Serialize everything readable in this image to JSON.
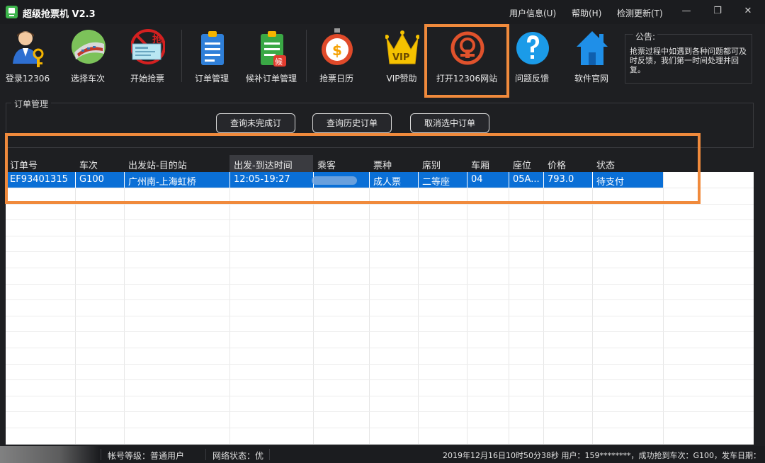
{
  "app": {
    "title": "超级抢票机 V2.3",
    "menu": [
      "用户信息(U)",
      "帮助(H)",
      "检测更新(T)"
    ]
  },
  "toolbar": {
    "items": [
      {
        "label": "登录12306",
        "icon": "user-key-icon"
      },
      {
        "label": "选择车次",
        "icon": "train-icon"
      },
      {
        "label": "开始抢票",
        "icon": "ticket-grab-icon"
      },
      {
        "label": "订单管理",
        "icon": "order-list-icon"
      },
      {
        "label": "候补订单管理",
        "icon": "waitlist-order-icon"
      },
      {
        "label": "抢票日历",
        "icon": "stopwatch-dollar-icon"
      },
      {
        "label": "VIP赞助",
        "icon": "vip-crown-icon"
      },
      {
        "label": "打开12306网站",
        "icon": "railway-logo-icon"
      },
      {
        "label": "问题反馈",
        "icon": "question-icon"
      },
      {
        "label": "软件官网",
        "icon": "home-icon"
      }
    ],
    "ticket_badge": "抢",
    "waitlist_badge": "候",
    "vip_text": "VIP"
  },
  "notice": {
    "title": "公告:",
    "text": "抢票过程中如遇到各种问题都可及时反馈，我们第一时间处理并回复。"
  },
  "orders": {
    "group_title": "订单管理",
    "buttons": [
      "查询未完成订",
      "查询历史订单",
      "取消选中订单"
    ],
    "columns": [
      "订单号",
      "车次",
      "出发站-目的站",
      "出发-到达时间",
      "乘客",
      "票种",
      "席别",
      "车厢",
      "座位",
      "价格",
      "状态"
    ],
    "rows": [
      {
        "order_no": "EF93401315",
        "train": "G100",
        "route": "广州南-上海虹桥",
        "time": "12:05-19:27",
        "passenger": "",
        "ticket_type": "成人票",
        "seat_class": "二等座",
        "car": "04",
        "seat": "05A...",
        "price": "793.0",
        "status": "待支付"
      }
    ],
    "selection_color": "#0a6fd6"
  },
  "statusbar": {
    "level": "帐号等级：普通用户",
    "network": "网络状态：优",
    "info": "2019年12月16日10时50分38秒 用户：159********，成功抢到车次：G100，发车日期："
  },
  "colors": {
    "highlight": "#f08a3c",
    "background": "#1e1f22"
  }
}
